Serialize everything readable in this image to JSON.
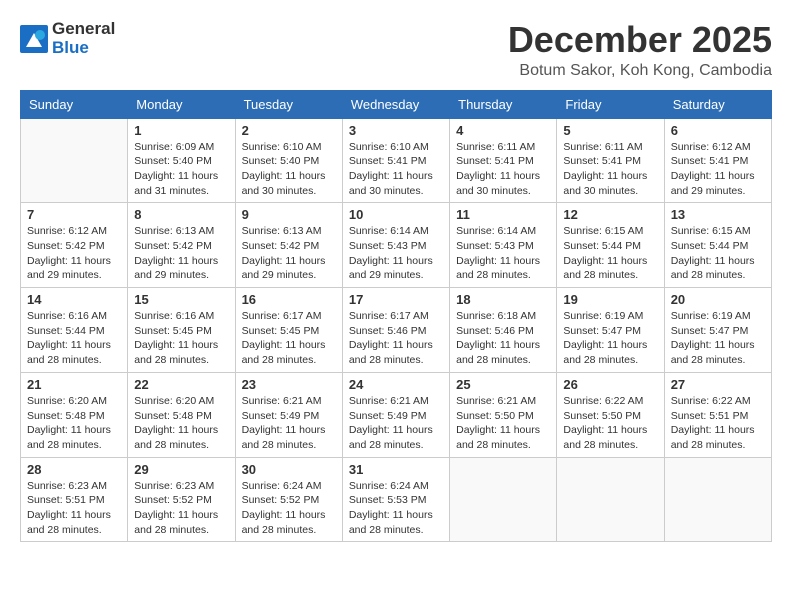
{
  "header": {
    "logo_line1": "General",
    "logo_line2": "Blue",
    "month": "December 2025",
    "location": "Botum Sakor, Koh Kong, Cambodia"
  },
  "weekdays": [
    "Sunday",
    "Monday",
    "Tuesday",
    "Wednesday",
    "Thursday",
    "Friday",
    "Saturday"
  ],
  "weeks": [
    [
      {
        "day": "",
        "info": ""
      },
      {
        "day": "1",
        "info": "Sunrise: 6:09 AM\nSunset: 5:40 PM\nDaylight: 11 hours\nand 31 minutes."
      },
      {
        "day": "2",
        "info": "Sunrise: 6:10 AM\nSunset: 5:40 PM\nDaylight: 11 hours\nand 30 minutes."
      },
      {
        "day": "3",
        "info": "Sunrise: 6:10 AM\nSunset: 5:41 PM\nDaylight: 11 hours\nand 30 minutes."
      },
      {
        "day": "4",
        "info": "Sunrise: 6:11 AM\nSunset: 5:41 PM\nDaylight: 11 hours\nand 30 minutes."
      },
      {
        "day": "5",
        "info": "Sunrise: 6:11 AM\nSunset: 5:41 PM\nDaylight: 11 hours\nand 30 minutes."
      },
      {
        "day": "6",
        "info": "Sunrise: 6:12 AM\nSunset: 5:41 PM\nDaylight: 11 hours\nand 29 minutes."
      }
    ],
    [
      {
        "day": "7",
        "info": "Sunrise: 6:12 AM\nSunset: 5:42 PM\nDaylight: 11 hours\nand 29 minutes."
      },
      {
        "day": "8",
        "info": "Sunrise: 6:13 AM\nSunset: 5:42 PM\nDaylight: 11 hours\nand 29 minutes."
      },
      {
        "day": "9",
        "info": "Sunrise: 6:13 AM\nSunset: 5:42 PM\nDaylight: 11 hours\nand 29 minutes."
      },
      {
        "day": "10",
        "info": "Sunrise: 6:14 AM\nSunset: 5:43 PM\nDaylight: 11 hours\nand 29 minutes."
      },
      {
        "day": "11",
        "info": "Sunrise: 6:14 AM\nSunset: 5:43 PM\nDaylight: 11 hours\nand 28 minutes."
      },
      {
        "day": "12",
        "info": "Sunrise: 6:15 AM\nSunset: 5:44 PM\nDaylight: 11 hours\nand 28 minutes."
      },
      {
        "day": "13",
        "info": "Sunrise: 6:15 AM\nSunset: 5:44 PM\nDaylight: 11 hours\nand 28 minutes."
      }
    ],
    [
      {
        "day": "14",
        "info": "Sunrise: 6:16 AM\nSunset: 5:44 PM\nDaylight: 11 hours\nand 28 minutes."
      },
      {
        "day": "15",
        "info": "Sunrise: 6:16 AM\nSunset: 5:45 PM\nDaylight: 11 hours\nand 28 minutes."
      },
      {
        "day": "16",
        "info": "Sunrise: 6:17 AM\nSunset: 5:45 PM\nDaylight: 11 hours\nand 28 minutes."
      },
      {
        "day": "17",
        "info": "Sunrise: 6:17 AM\nSunset: 5:46 PM\nDaylight: 11 hours\nand 28 minutes."
      },
      {
        "day": "18",
        "info": "Sunrise: 6:18 AM\nSunset: 5:46 PM\nDaylight: 11 hours\nand 28 minutes."
      },
      {
        "day": "19",
        "info": "Sunrise: 6:19 AM\nSunset: 5:47 PM\nDaylight: 11 hours\nand 28 minutes."
      },
      {
        "day": "20",
        "info": "Sunrise: 6:19 AM\nSunset: 5:47 PM\nDaylight: 11 hours\nand 28 minutes."
      }
    ],
    [
      {
        "day": "21",
        "info": "Sunrise: 6:20 AM\nSunset: 5:48 PM\nDaylight: 11 hours\nand 28 minutes."
      },
      {
        "day": "22",
        "info": "Sunrise: 6:20 AM\nSunset: 5:48 PM\nDaylight: 11 hours\nand 28 minutes."
      },
      {
        "day": "23",
        "info": "Sunrise: 6:21 AM\nSunset: 5:49 PM\nDaylight: 11 hours\nand 28 minutes."
      },
      {
        "day": "24",
        "info": "Sunrise: 6:21 AM\nSunset: 5:49 PM\nDaylight: 11 hours\nand 28 minutes."
      },
      {
        "day": "25",
        "info": "Sunrise: 6:21 AM\nSunset: 5:50 PM\nDaylight: 11 hours\nand 28 minutes."
      },
      {
        "day": "26",
        "info": "Sunrise: 6:22 AM\nSunset: 5:50 PM\nDaylight: 11 hours\nand 28 minutes."
      },
      {
        "day": "27",
        "info": "Sunrise: 6:22 AM\nSunset: 5:51 PM\nDaylight: 11 hours\nand 28 minutes."
      }
    ],
    [
      {
        "day": "28",
        "info": "Sunrise: 6:23 AM\nSunset: 5:51 PM\nDaylight: 11 hours\nand 28 minutes."
      },
      {
        "day": "29",
        "info": "Sunrise: 6:23 AM\nSunset: 5:52 PM\nDaylight: 11 hours\nand 28 minutes."
      },
      {
        "day": "30",
        "info": "Sunrise: 6:24 AM\nSunset: 5:52 PM\nDaylight: 11 hours\nand 28 minutes."
      },
      {
        "day": "31",
        "info": "Sunrise: 6:24 AM\nSunset: 5:53 PM\nDaylight: 11 hours\nand 28 minutes."
      },
      {
        "day": "",
        "info": ""
      },
      {
        "day": "",
        "info": ""
      },
      {
        "day": "",
        "info": ""
      }
    ]
  ]
}
